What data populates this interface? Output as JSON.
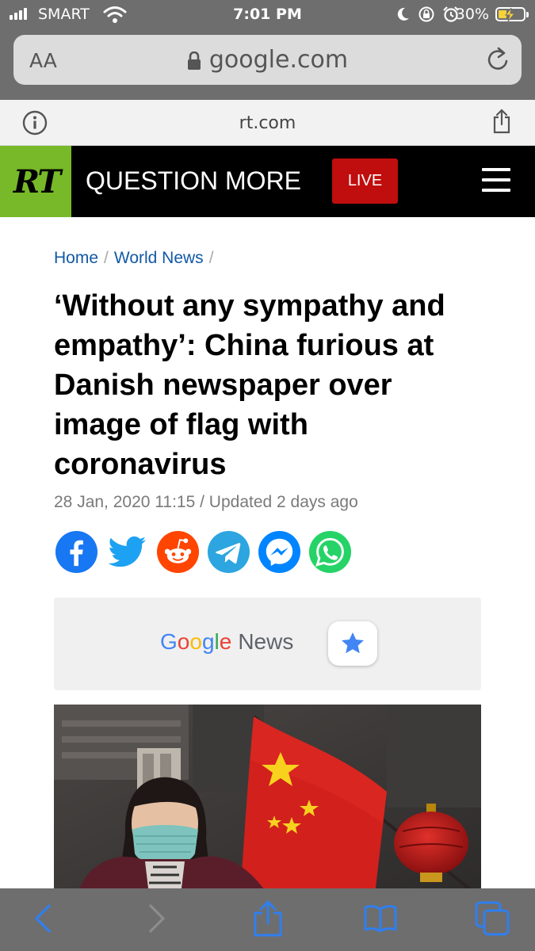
{
  "status_bar": {
    "carrier": "SMART",
    "time": "7:01 PM",
    "battery_percent": "30%",
    "battery_level": 0.3,
    "icons": [
      "signal-icon",
      "wifi-icon",
      "moon-icon",
      "rotation-lock-icon",
      "alarm-icon",
      "battery-charging-icon"
    ]
  },
  "browser": {
    "text_size_label": "AA",
    "url": "google.com",
    "site": "rt.com",
    "icons": [
      "lock-icon",
      "reload-icon",
      "info-icon",
      "share-icon"
    ]
  },
  "rt_header": {
    "logo": "RT",
    "slogan": "QUESTION MORE",
    "live_label": "LIVE",
    "colors": {
      "logo_bg": "#77b928",
      "live_bg": "#c00d0d",
      "header_bg": "#000000"
    }
  },
  "article": {
    "breadcrumb": [
      {
        "label": "Home"
      },
      {
        "label": "World News"
      }
    ],
    "breadcrumb_separator": "/",
    "headline": "‘Without any sympathy and empathy’: China furious at Danish newspaper over image of flag with coronavirus",
    "date": "28 Jan, 2020 11:15",
    "updated": "Updated 2 days ago",
    "date_separator": "/",
    "share_buttons": [
      {
        "name": "facebook",
        "color": "#1877f2"
      },
      {
        "name": "twitter",
        "color": "#1da1f2"
      },
      {
        "name": "reddit",
        "color": "#ff4500"
      },
      {
        "name": "telegram",
        "color": "#2ca5e0"
      },
      {
        "name": "messenger",
        "color": "#0084ff"
      },
      {
        "name": "whatsapp",
        "color": "#25d366"
      }
    ]
  },
  "google_news": {
    "logo_letters": [
      "G",
      "o",
      "o",
      "g",
      "l",
      "e"
    ],
    "label": "News"
  },
  "photo": {
    "icons": [
      "woman-with-mask",
      "china-flag",
      "red-lantern"
    ]
  },
  "toolbar": {
    "buttons": [
      "back-icon",
      "forward-icon",
      "share-icon",
      "bookmarks-icon",
      "tabs-icon"
    ]
  }
}
